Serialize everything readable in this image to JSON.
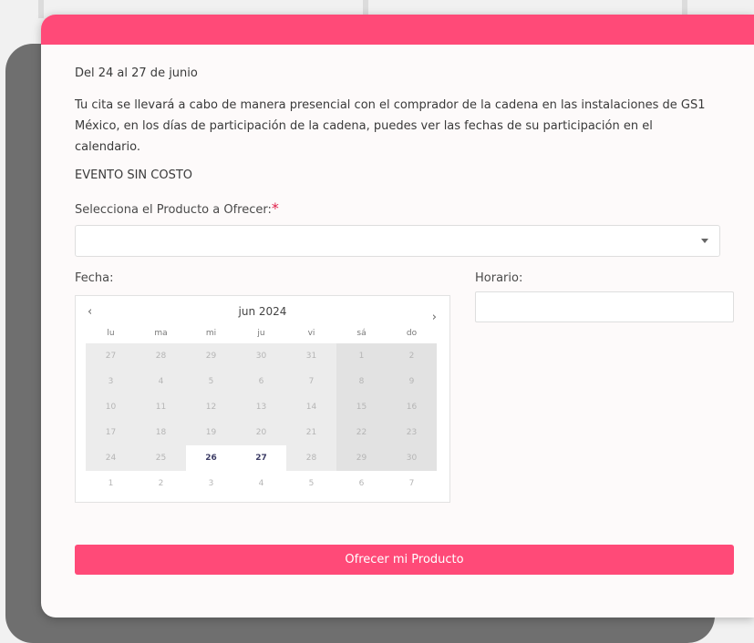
{
  "form": {
    "dates_text": "Del 24 al 27 de junio",
    "description": "Tu cita se llevará a cabo de manera presencial con el comprador de la cadena en las instalaciones de GS1 México, en los días de participación de la cadena, puedes ver las fechas de su participación en el calendario.",
    "event_note": "EVENTO SIN COSTO",
    "product_label": "Selecciona el Producto a Ofrecer:",
    "required_mark": "*",
    "product_value": "",
    "fecha_label": "Fecha:",
    "horario_label": "Horario:",
    "horario_value": "",
    "submit_label": "Ofrecer mi Producto"
  },
  "calendar": {
    "prev": "‹",
    "month_year": "jun  2024",
    "next": "›",
    "weekdays": [
      "lu",
      "ma",
      "mi",
      "ju",
      "vi",
      "sá",
      "do"
    ],
    "weeks": [
      [
        "27",
        "28",
        "29",
        "30",
        "31",
        "1",
        "2"
      ],
      [
        "3",
        "4",
        "5",
        "6",
        "7",
        "8",
        "9"
      ],
      [
        "10",
        "11",
        "12",
        "13",
        "14",
        "15",
        "16"
      ],
      [
        "17",
        "18",
        "19",
        "20",
        "21",
        "22",
        "23"
      ],
      [
        "24",
        "25",
        "26",
        "27",
        "28",
        "29",
        "30"
      ],
      [
        "1",
        "2",
        "3",
        "4",
        "5",
        "6",
        "7"
      ]
    ],
    "available_days": [
      "26",
      "27"
    ]
  },
  "colors": {
    "accent": "#ff4a78",
    "required": "#e0204a"
  }
}
